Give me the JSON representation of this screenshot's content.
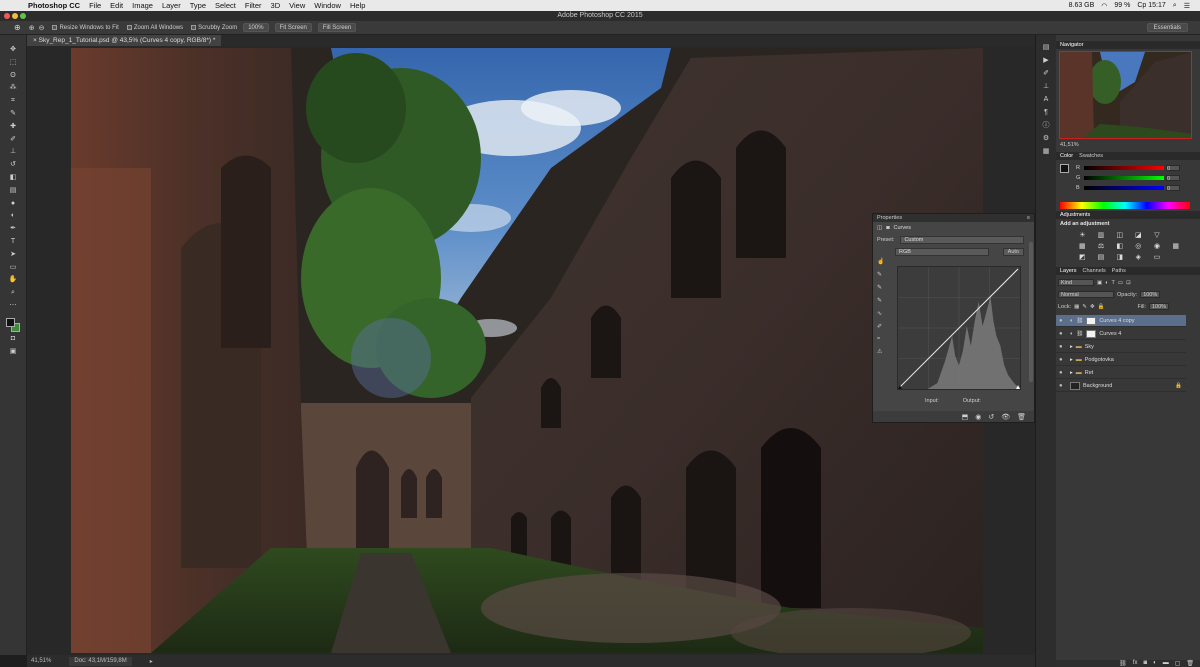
{
  "menubar": {
    "app": "Photoshop CC",
    "items": [
      "File",
      "Edit",
      "Image",
      "Layer",
      "Type",
      "Select",
      "Filter",
      "3D",
      "View",
      "Window",
      "Help"
    ],
    "memory": "8.63 GB",
    "battery": "99 %",
    "clock": "Ср 15:17"
  },
  "window": {
    "title": "Adobe Photoshop CC 2015"
  },
  "options": {
    "resize_windows": "Resize Windows to Fit",
    "zoom_all": "Zoom All Windows",
    "scrubby": "Scrubby Zoom",
    "pct": "100%",
    "fit": "Fit Screen",
    "fill": "Fill Screen",
    "workspace": "Essentials"
  },
  "document": {
    "tab": "Sky_Rep_1_Tutorial.psd @ 43,5% (Curves 4 copy, RGB/8*) *",
    "zoom": "41,51%",
    "doc_size": "Doc: 43,1M/159,8M"
  },
  "properties": {
    "tab": "Properties",
    "adjustment": "Curves",
    "preset_label": "Preset:",
    "preset_value": "Custom",
    "channel": "RGB",
    "auto": "Auto",
    "input": "Input:",
    "output": "Output:"
  },
  "navigator": {
    "tab": "Navigator",
    "zoom": "41,51%"
  },
  "color": {
    "tabs": [
      "Color",
      "Swatches"
    ],
    "sliders": [
      {
        "label": "R",
        "value": "0"
      },
      {
        "label": "G",
        "value": "0"
      },
      {
        "label": "B",
        "value": "0"
      }
    ]
  },
  "adjustments": {
    "tab": "Adjustments",
    "title": "Add an adjustment"
  },
  "layers": {
    "tabs": [
      "Layers",
      "Channels",
      "Paths"
    ],
    "kind": "Kind",
    "blend": "Normal",
    "opacity_label": "Opacity:",
    "opacity": "100%",
    "lock_label": "Lock:",
    "fill_label": "Fill:",
    "fill": "100%",
    "rows": [
      {
        "name": "Curves 4 copy",
        "type": "adjustment",
        "selected": true
      },
      {
        "name": "Curves 4",
        "type": "adjustment",
        "selected": false
      },
      {
        "name": "Sky",
        "type": "group",
        "selected": false
      },
      {
        "name": "Podgotovka",
        "type": "group",
        "selected": false
      },
      {
        "name": "Ret",
        "type": "group",
        "selected": false
      },
      {
        "name": "Background",
        "type": "pixel",
        "selected": false
      }
    ]
  },
  "colors": {
    "sky_blue": "#3f6fb4",
    "brick": "#4a3a33",
    "foliage": "#3c5a28",
    "selection": "#5b6e8c",
    "nav_frame": "#c81f1f"
  }
}
